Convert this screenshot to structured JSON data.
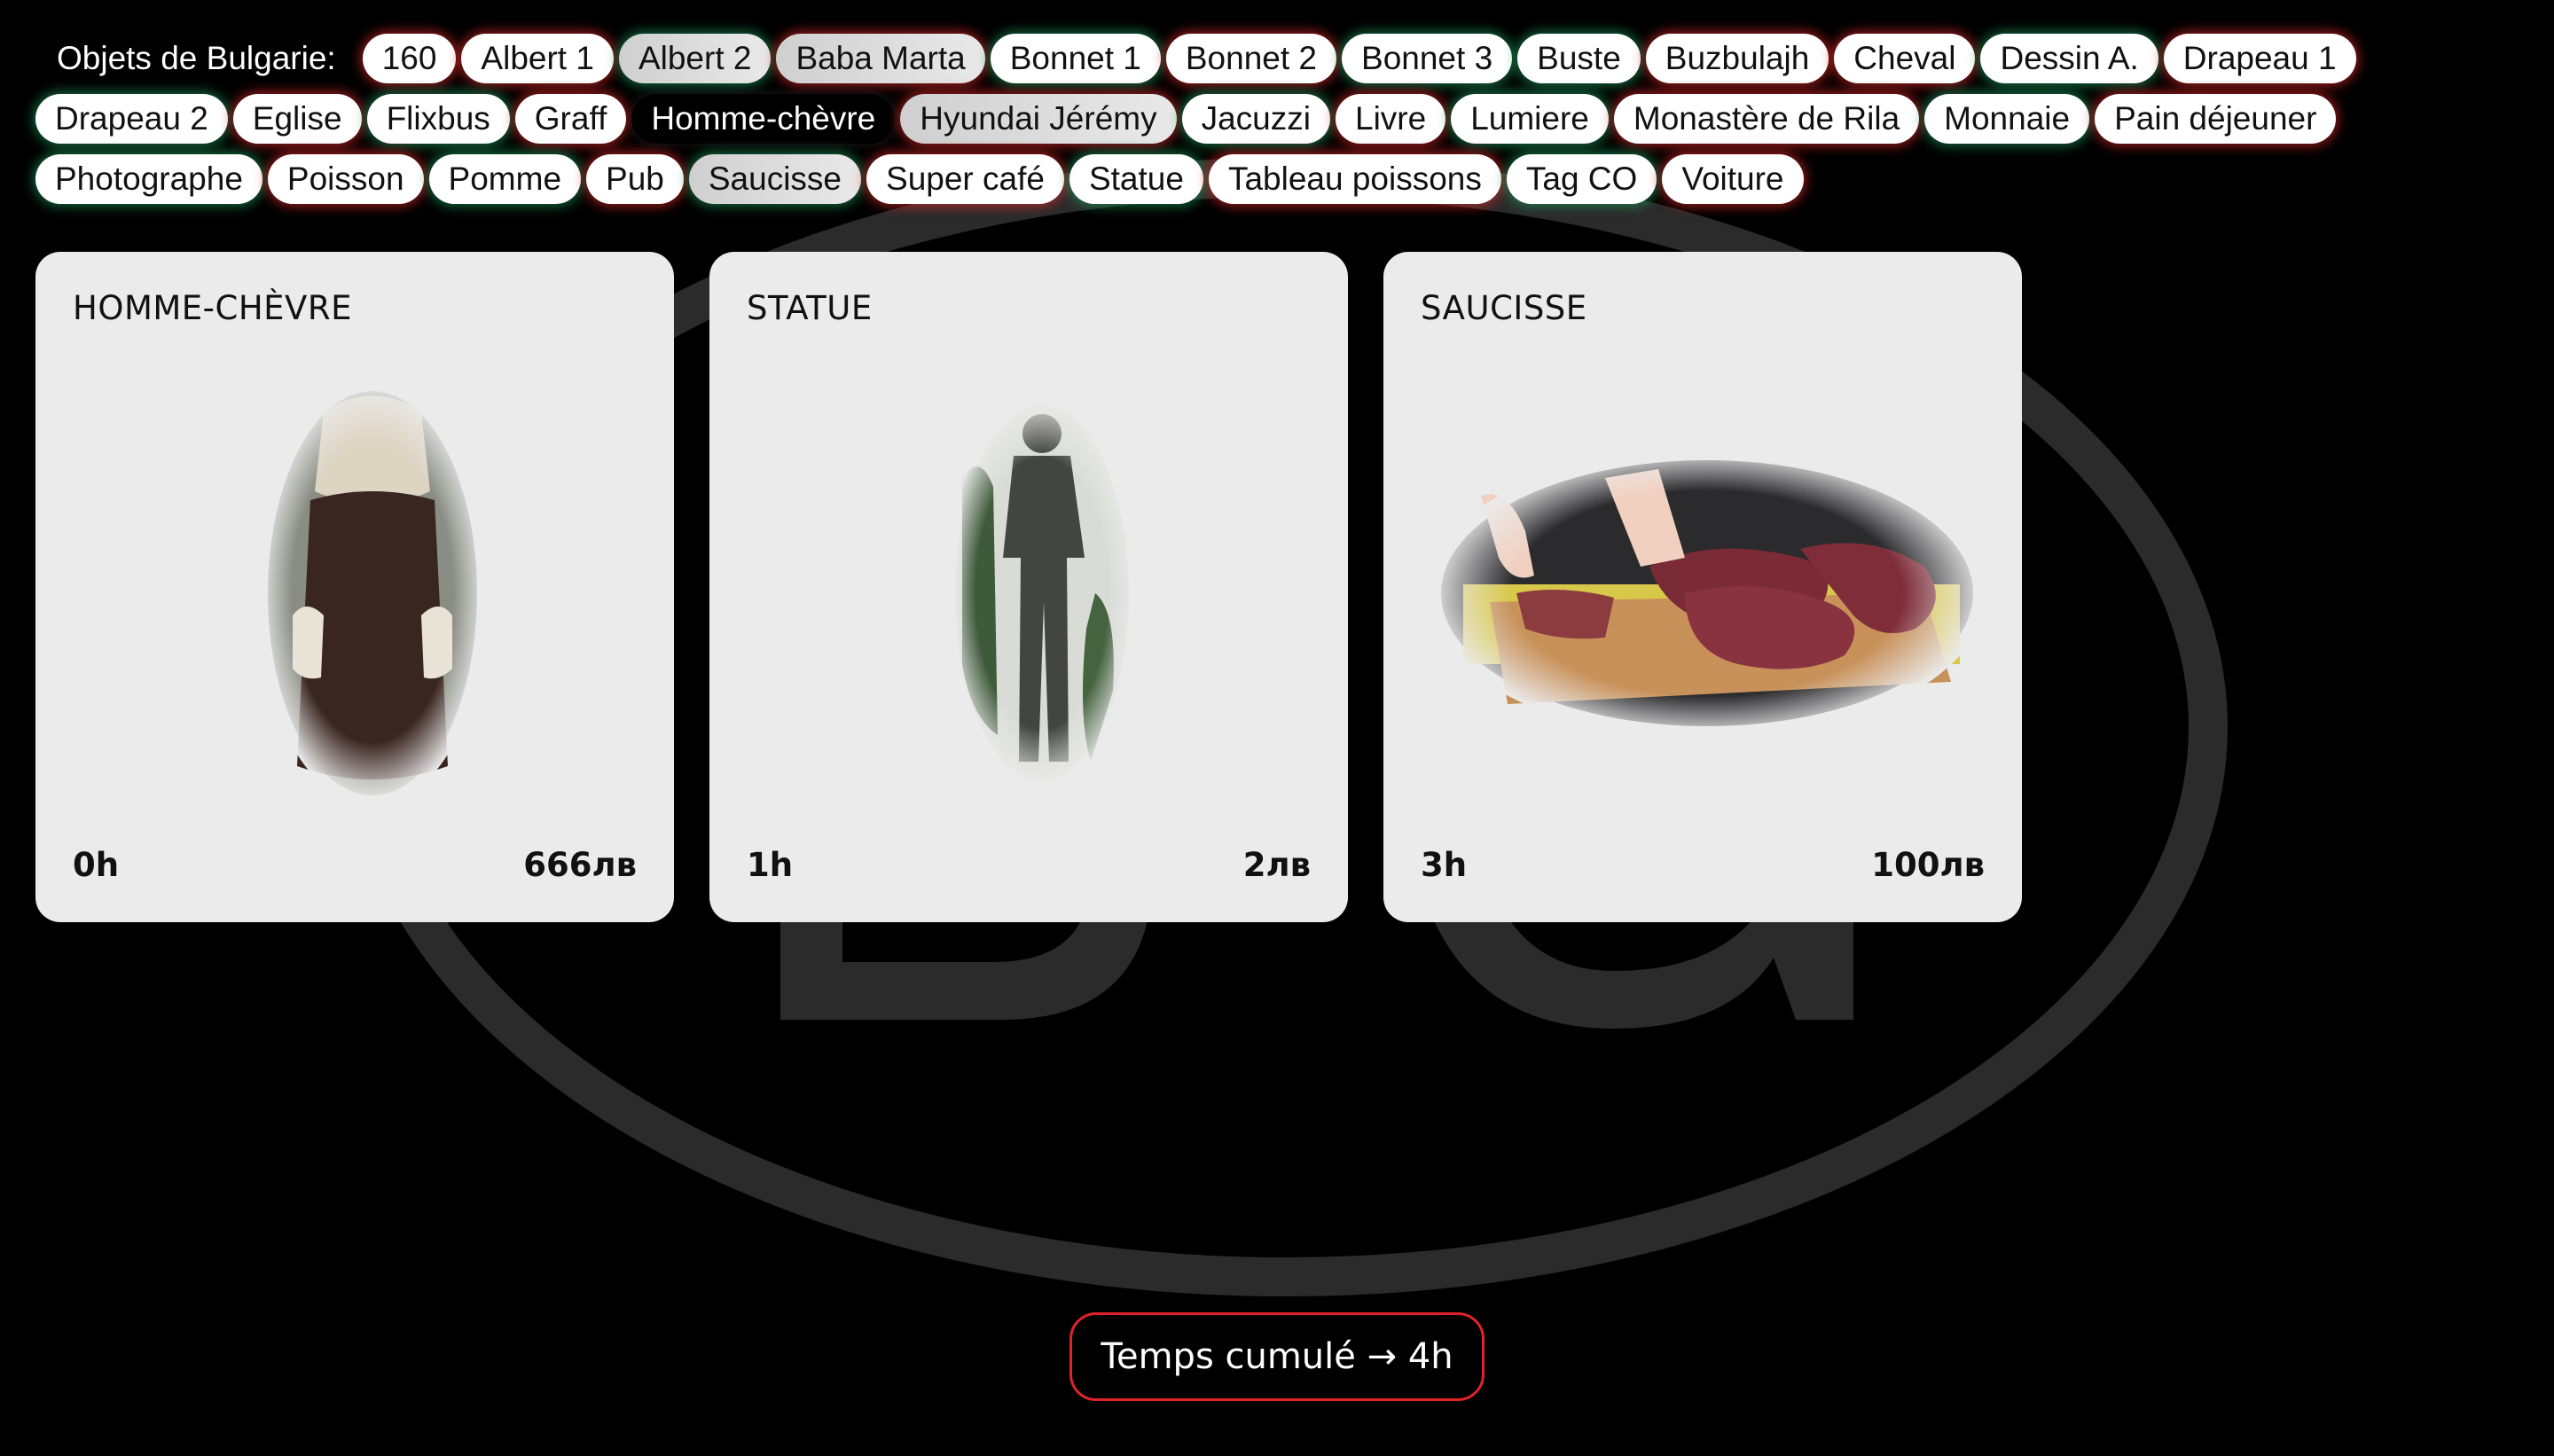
{
  "filter": {
    "label": "Objets de Bulgarie:",
    "tags": [
      {
        "label": "160",
        "glow": "red",
        "state": "normal"
      },
      {
        "label": "Albert 1",
        "glow": "red",
        "state": "normal"
      },
      {
        "label": "Albert 2",
        "glow": "green",
        "state": "dim"
      },
      {
        "label": "Baba Marta",
        "glow": "red",
        "state": "dim"
      },
      {
        "label": "Bonnet 1",
        "glow": "green",
        "state": "normal"
      },
      {
        "label": "Bonnet 2",
        "glow": "red",
        "state": "normal"
      },
      {
        "label": "Bonnet 3",
        "glow": "green",
        "state": "normal"
      },
      {
        "label": "Buste",
        "glow": "green",
        "state": "normal"
      },
      {
        "label": "Buzbulajh",
        "glow": "red",
        "state": "normal"
      },
      {
        "label": "Cheval",
        "glow": "red",
        "state": "normal"
      },
      {
        "label": "Dessin A.",
        "glow": "green",
        "state": "normal"
      },
      {
        "label": "Drapeau 1",
        "glow": "red",
        "state": "normal"
      },
      {
        "label": "Drapeau 2",
        "glow": "green",
        "state": "normal"
      },
      {
        "label": "Eglise",
        "glow": "red",
        "state": "normal"
      },
      {
        "label": "Flixbus",
        "glow": "green",
        "state": "normal"
      },
      {
        "label": "Graff",
        "glow": "red",
        "state": "normal"
      },
      {
        "label": "Homme-chèvre",
        "glow": "none",
        "state": "active"
      },
      {
        "label": "Hyundai Jérémy",
        "glow": "red",
        "state": "dim"
      },
      {
        "label": "Jacuzzi",
        "glow": "green",
        "state": "normal"
      },
      {
        "label": "Livre",
        "glow": "red",
        "state": "normal"
      },
      {
        "label": "Lumiere",
        "glow": "green",
        "state": "normal"
      },
      {
        "label": "Monastère de Rila",
        "glow": "red",
        "state": "normal"
      },
      {
        "label": "Monnaie",
        "glow": "green",
        "state": "normal"
      },
      {
        "label": "Pain déjeuner",
        "glow": "red",
        "state": "normal"
      },
      {
        "label": "Photographe",
        "glow": "green",
        "state": "normal"
      },
      {
        "label": "Poisson",
        "glow": "red",
        "state": "normal"
      },
      {
        "label": "Pomme",
        "glow": "green",
        "state": "normal"
      },
      {
        "label": "Pub",
        "glow": "red",
        "state": "normal"
      },
      {
        "label": "Saucisse",
        "glow": "green",
        "state": "dim"
      },
      {
        "label": "Super café",
        "glow": "red",
        "state": "normal"
      },
      {
        "label": "Statue",
        "glow": "green",
        "state": "normal"
      },
      {
        "label": "Tableau poissons",
        "glow": "red",
        "state": "normal"
      },
      {
        "label": "Tag CO",
        "glow": "green",
        "state": "normal"
      },
      {
        "label": "Voiture",
        "glow": "red",
        "state": "normal"
      }
    ]
  },
  "cards": [
    {
      "title": "HOMME-CHÈVRE",
      "time": "0h",
      "price": "666лв",
      "image": "goat-man-costume"
    },
    {
      "title": "STATUE",
      "time": "1h",
      "price": "2лв",
      "image": "bronze-statue"
    },
    {
      "title": "SAUCISSE",
      "time": "3h",
      "price": "100лв",
      "image": "sausage-cutting-board"
    }
  ],
  "footer": {
    "total_label": "Temps cumulé → 4h"
  },
  "colors": {
    "background": "#000000",
    "card": "#ebebeb",
    "accent_red": "#e0232b",
    "glow_green": "#1e965a",
    "emblem": "#2b2b2b"
  }
}
